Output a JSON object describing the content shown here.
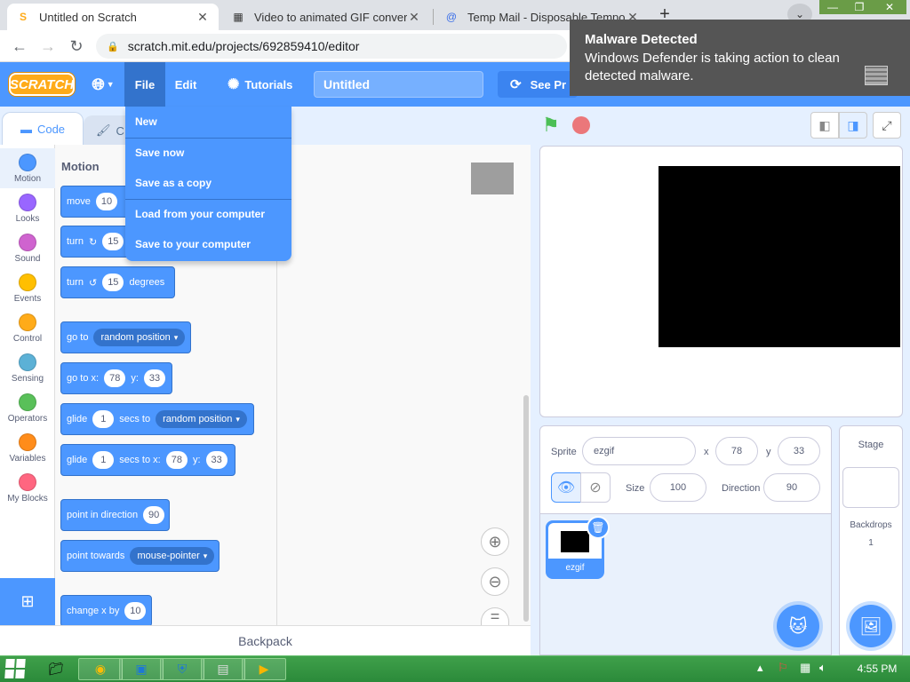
{
  "browser": {
    "tabs": [
      {
        "title": "Untitled on Scratch",
        "favicon": "scratch-favicon"
      },
      {
        "title": "Video to animated GIF converter",
        "favicon": "ezgif-favicon"
      },
      {
        "title": "Temp Mail - Disposable Tempora",
        "favicon": "tempmail-favicon"
      }
    ],
    "new_tab": "+",
    "url": "scratch.mit.edu/projects/692859410/editor"
  },
  "menubar": {
    "logo": "SCRATCH",
    "file": "File",
    "edit": "Edit",
    "tutorials": "Tutorials",
    "project_title": "Untitled",
    "see_project": "See Pr"
  },
  "file_menu": {
    "items": [
      "New",
      "Save now",
      "Save as a copy",
      "Load from your computer",
      "Save to your computer"
    ]
  },
  "editor_tabs": {
    "code": "Code",
    "costumes": "C"
  },
  "categories": [
    {
      "label": "Motion",
      "color": "#4c97ff"
    },
    {
      "label": "Looks",
      "color": "#9966ff"
    },
    {
      "label": "Sound",
      "color": "#cf63cf"
    },
    {
      "label": "Events",
      "color": "#ffbf00"
    },
    {
      "label": "Control",
      "color": "#ffab19"
    },
    {
      "label": "Sensing",
      "color": "#5cb1d6"
    },
    {
      "label": "Operators",
      "color": "#59c059"
    },
    {
      "label": "Variables",
      "color": "#ff8c1a"
    },
    {
      "label": "My Blocks",
      "color": "#ff6680"
    }
  ],
  "palette": {
    "title": "Motion",
    "blocks": {
      "move": {
        "label": "move",
        "value": "10"
      },
      "turn_right": {
        "label": "turn",
        "value": "15"
      },
      "turn_left": {
        "label": "turn",
        "value": "15",
        "suffix": "degrees"
      },
      "goto": {
        "label": "go to",
        "option": "random position"
      },
      "goto_xy": {
        "label": "go to x:",
        "x": "78",
        "ylabel": "y:",
        "y": "33"
      },
      "glide": {
        "label": "glide",
        "value": "1",
        "mid": "secs to",
        "option": "random position"
      },
      "glide_xy": {
        "label": "glide",
        "value": "1",
        "mid": "secs to x:",
        "x": "78",
        "ylabel": "y:",
        "y": "33"
      },
      "point_dir": {
        "label": "point in direction",
        "value": "90"
      },
      "point_towards": {
        "label": "point towards",
        "option": "mouse-pointer"
      },
      "change_x": {
        "label": "change x by",
        "value": "10"
      }
    }
  },
  "backpack": "Backpack",
  "sprite_info": {
    "sprite_label": "Sprite",
    "sprite_name": "ezgif",
    "x_label": "x",
    "x": "78",
    "y_label": "y",
    "y": "33",
    "size_label": "Size",
    "size": "100",
    "direction_label": "Direction",
    "direction": "90"
  },
  "sprite_list": [
    {
      "name": "ezgif"
    }
  ],
  "stage_panel": {
    "title": "Stage",
    "backdrops_label": "Backdrops",
    "backdrops_count": "1"
  },
  "notification": {
    "title": "Malware Detected",
    "body": "Windows Defender is taking action to clean detected malware."
  },
  "taskbar": {
    "time": "4:55 PM"
  }
}
